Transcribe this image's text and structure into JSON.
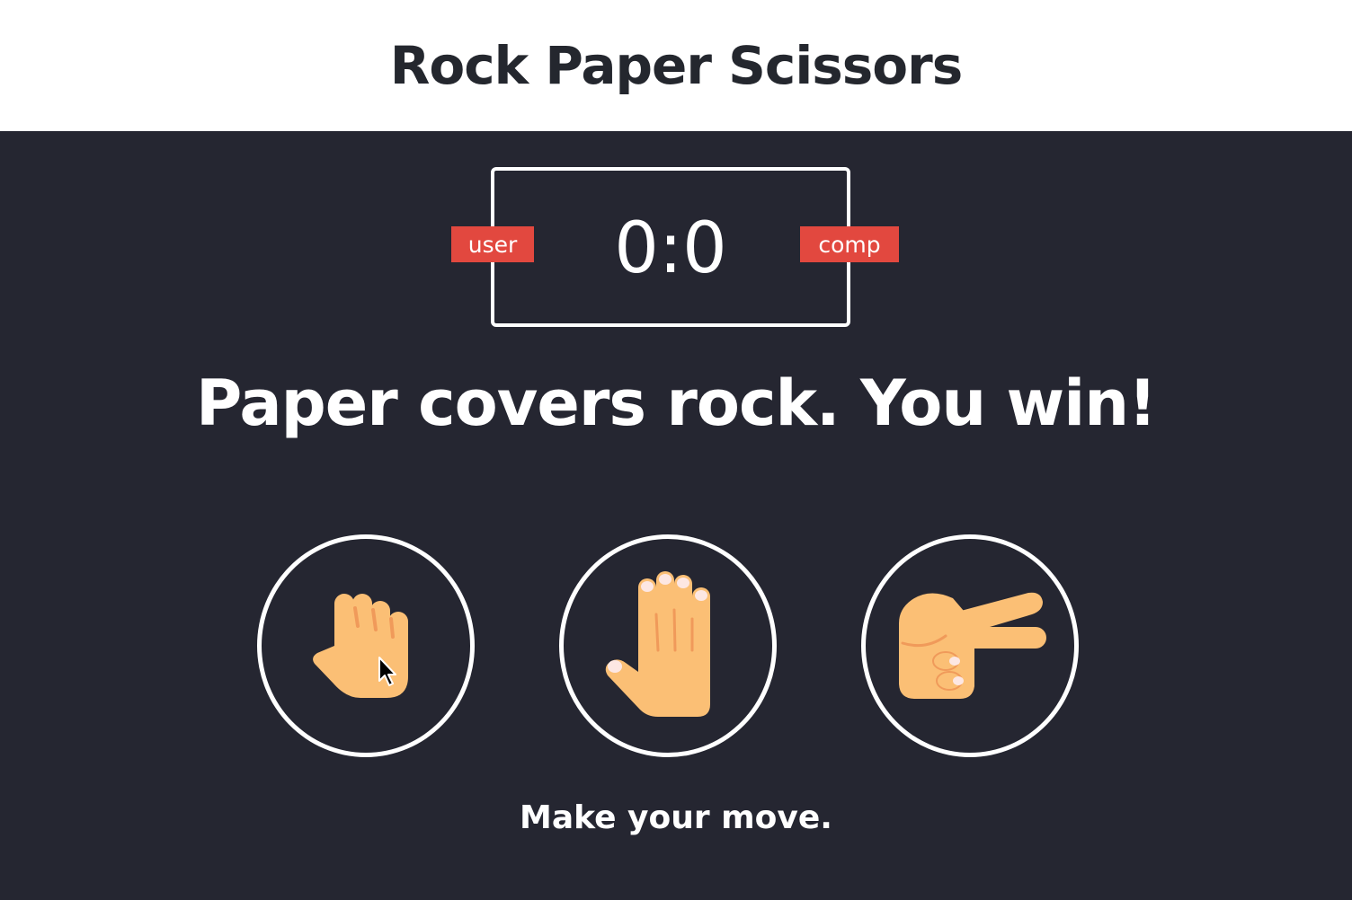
{
  "header": {
    "title": "Rock Paper Scissors"
  },
  "scoreboard": {
    "score": "0:0",
    "user_label": "user",
    "comp_label": "comp"
  },
  "result": {
    "text": "Paper covers rock. You win!"
  },
  "choices": [
    {
      "id": "rock",
      "icon": "rock-hand-icon"
    },
    {
      "id": "paper",
      "icon": "paper-hand-icon"
    },
    {
      "id": "scissors",
      "icon": "scissors-hand-icon"
    }
  ],
  "message": {
    "text": "Make your move."
  },
  "colors": {
    "background": "#252631",
    "badge": "#e2483f",
    "skin": "#fbbf75",
    "skin_shadow": "#f09a5a",
    "nail": "#fde7e3"
  }
}
